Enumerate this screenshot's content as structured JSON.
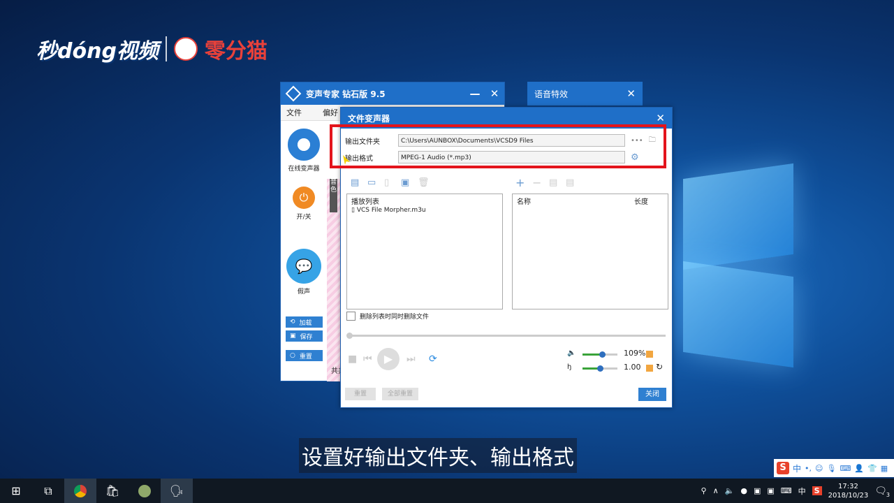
{
  "watermark": {
    "brand": "秒dóng视频",
    "partner": "零分猫"
  },
  "main_window": {
    "title": "变声专家  钻石版  9.5",
    "menu": [
      "文件",
      "偏好"
    ],
    "online_label": "在线变声器",
    "power_label": "开/关",
    "fake_voice_label": "假声",
    "pink_tab": "音色",
    "buttons": {
      "load": "加载",
      "save": "保存",
      "reset": "重置"
    },
    "footer_text": "共共"
  },
  "effect_window": {
    "title": "语音特效"
  },
  "dialog": {
    "title": "文件变声器",
    "output_folder_label": "输出文件夹",
    "output_folder_value": "C:\\Users\\AUNBOX\\Documents\\VCSD9 Files",
    "output_format_label": "输出格式",
    "output_format_value": "MPEG-1 Audio (*.mp3)",
    "playlist_header": "播放列表",
    "playlist_items": [
      "VCS File Morpher.m3u"
    ],
    "files_header_name": "名称",
    "files_header_length": "长度",
    "delete_checkbox_label": "删除列表时同时删除文件",
    "volume_value": "109%",
    "tempo_value": "1.00",
    "btn_reset": "重置",
    "btn_reset_all": "全部重置",
    "btn_close": "关闭"
  },
  "subtitle": "设置好输出文件夹、输出格式",
  "ime": {
    "lang": "中"
  },
  "taskbar": {
    "tray_lang": "中",
    "time": "17:32",
    "date": "2018/10/23",
    "notif_count": "3"
  }
}
